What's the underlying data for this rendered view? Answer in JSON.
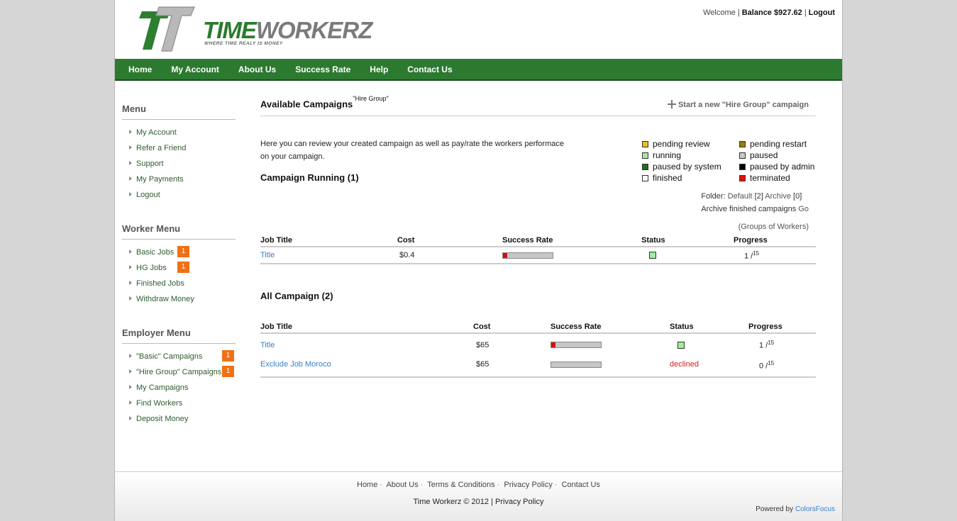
{
  "logo": {
    "word_green": "TIME",
    "word_gray": "WORKERZ",
    "tagline": "WHERE TIME REALY IS MONEY"
  },
  "topbar": {
    "welcome": "Welcome",
    "sep": "|",
    "balance": "Balance $927.62",
    "logout": "Logout"
  },
  "nav": [
    "Home",
    "My Account",
    "About Us",
    "Success Rate",
    "Help",
    "Contact Us"
  ],
  "sidebar": {
    "menu_title": "Menu",
    "menu": [
      "My Account",
      "Refer a Friend",
      "Support",
      "My Payments",
      "Logout"
    ],
    "worker_title": "Worker Menu",
    "worker": [
      {
        "label": "Basic Jobs",
        "badge": "1"
      },
      {
        "label": "HG Jobs",
        "badge": "1"
      },
      {
        "label": "Finished Jobs",
        "badge": ""
      },
      {
        "label": "Withdraw Money",
        "badge": ""
      }
    ],
    "employer_title": "Employer Menu",
    "employer": [
      {
        "label": "\"Basic\" Campaigns",
        "badge": "1"
      },
      {
        "label": "\"Hire Group\" Campaigns",
        "badge": "1"
      },
      {
        "label": "My Campaigns",
        "badge": ""
      },
      {
        "label": "Find Workers",
        "badge": ""
      },
      {
        "label": "Deposit Money",
        "badge": ""
      }
    ]
  },
  "main": {
    "title": "Available Campaigns",
    "title_sup": "\"Hire Group\"",
    "start_link": "Start a new \"Hire Group\" campaign",
    "intro": "Here you can review your created campaign as well as pay/rate the workers performace on your campaign.",
    "running_title": "Campaign Running (1)",
    "all_title": "All Campaign (2)",
    "legend": [
      {
        "label": "pending review",
        "color": "#e8c21a"
      },
      {
        "label": "pending restart",
        "color": "#9a7a12"
      },
      {
        "label": "running",
        "color": "#9cf09c"
      },
      {
        "label": "paused",
        "color": "#c8c8c8"
      },
      {
        "label": "paused by system",
        "color": "#1d6e1d"
      },
      {
        "label": "paused by admin",
        "color": "#000000"
      },
      {
        "label": "finished",
        "color": "#ffffff"
      },
      {
        "label": "terminated",
        "color": "#e01010"
      }
    ],
    "folder": {
      "label": "Folder:",
      "default": "Default",
      "default_count": "[2]",
      "archive": "Archive",
      "archive_count": "[0]"
    },
    "archive": {
      "label": "Archive finished campaigns",
      "go": "Go"
    },
    "groups": "(Groups of Workers)",
    "columns": [
      "Job Title",
      "Cost",
      "Success Rate",
      "Status",
      "Progress"
    ],
    "running_rows": [
      {
        "title": "Title",
        "cost": "$0.4",
        "success": 0.08,
        "status_color": "#9cf09c",
        "status_text": "",
        "done": "1 /",
        "total": "15"
      }
    ],
    "all_rows": [
      {
        "title": "Title",
        "cost": "$65",
        "success": 0.08,
        "status_color": "#9cf09c",
        "status_text": "",
        "done": "1 /",
        "total": "15"
      },
      {
        "title": "Exclude Job Moroco",
        "cost": "$65",
        "success": 0,
        "status_color": "",
        "status_text": "declined",
        "done": "0 /",
        "total": "15"
      }
    ]
  },
  "footer": {
    "links": [
      "Home",
      "About Us",
      "Terms & Conditions",
      "Privacy Policy",
      "Contact Us"
    ],
    "copyright": "Time Workerz © 2012",
    "copyright_sep": "|",
    "copyright_link": "Privacy Policy",
    "powered_by": "Powered by",
    "powered_company": "ColorsFocus"
  }
}
